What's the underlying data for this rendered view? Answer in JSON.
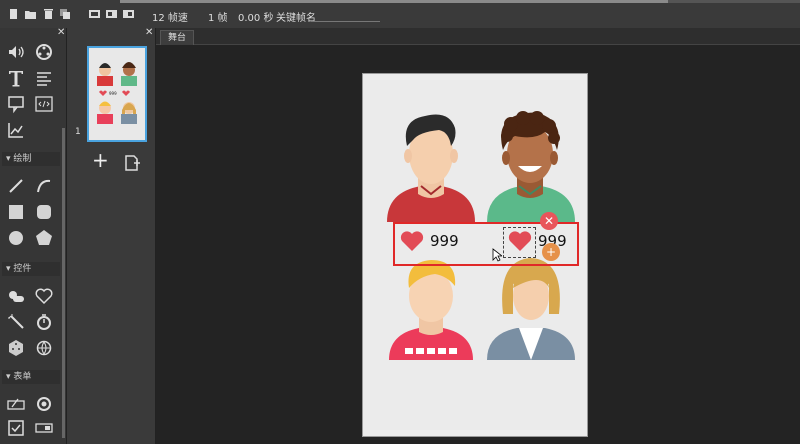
{
  "toolbar": {
    "fps": "12 帧速",
    "frame": "1 帧",
    "time": "0.00 秒",
    "keyframe_label": "关键帧名",
    "keyframe_value": "",
    "icons": [
      "new-file-icon",
      "open-folder-icon",
      "delete-icon",
      "copy-icon",
      "frame-icon",
      "frame-copy-icon",
      "frame-paste-icon"
    ]
  },
  "tools": {
    "top": [
      "sound-icon",
      "video-icon",
      "text-icon",
      "paragraph-icon",
      "speech-bubble-icon",
      "html-code-icon",
      "chart-icon"
    ],
    "draw_section": "绘制",
    "draw": [
      "line-icon",
      "curve-icon",
      "rectangle-icon",
      "rounded-rectangle-icon",
      "circle-icon",
      "pentagon-icon"
    ],
    "control_section": "控件",
    "control": [
      "switch-icon",
      "heart-icon",
      "magic-wand-icon",
      "timer-icon",
      "dice-icon",
      "globe-icon"
    ],
    "form_section": "表单",
    "form": [
      "input-field-icon",
      "radio-button-icon",
      "checkbox-icon",
      "toggle-icon"
    ]
  },
  "frames": {
    "frame_number": "1",
    "thumb_count": "999",
    "add_frame": "+"
  },
  "stage": {
    "tab": "舞台",
    "like_count_left": "999",
    "like_count_right": "999",
    "colors": {
      "like": "#e24b56",
      "selection": "#e02828",
      "badge_red": "#e8555b",
      "badge_orange": "#e6914a"
    }
  }
}
